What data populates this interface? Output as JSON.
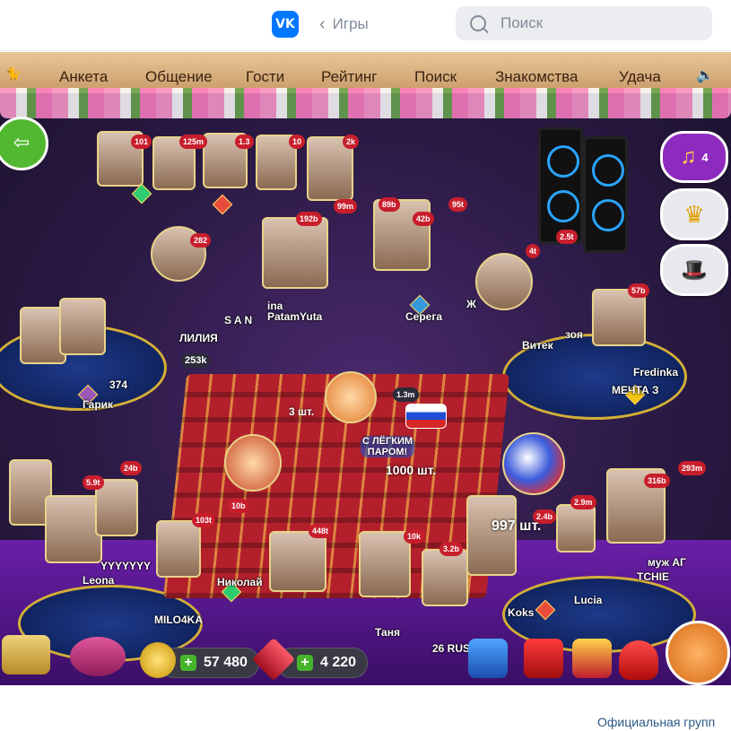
{
  "header": {
    "logo": "VK",
    "back_label": "Игры",
    "search_placeholder": "Поиск"
  },
  "game_nav": {
    "items": [
      "Анкета",
      "Общение",
      "Гости",
      "Рейтинг",
      "Поиск",
      "Знакомства",
      "Удача"
    ]
  },
  "badges": [
    "101",
    "125m",
    "1.3",
    "10",
    "2k",
    "99m",
    "89b",
    "42b",
    "95t",
    "192b",
    "282",
    "4t",
    "2.5t",
    "57b",
    "253k",
    "1.3m",
    "24b",
    "5.9t",
    "103t",
    "10b",
    "448t",
    "10k",
    "3.2b",
    "2.4b",
    "2.9m",
    "316b",
    "293m"
  ],
  "names": [
    "S A N",
    "ina",
    "PatamYuta",
    "Серега",
    "Ж",
    "ЛИЛИЯ",
    "Витек",
    "зоя",
    "Fredinka",
    "МЕЧТА З",
    "Гарик",
    "374",
    "Leona",
    "YYYYYYY",
    "Николай",
    "MILO4KA",
    "Таня",
    "26 RUS",
    "Koks",
    "Lucia",
    "муж АГ",
    "TCHIE"
  ],
  "gifts": {
    "gift1_count": "3 шт.",
    "gift2_count": "1000 шт.",
    "gift2_label": "С ЛЁГКИМ ПАРОМ!",
    "gift3_count": "997 шт."
  },
  "side_buttons": {
    "music_count": "4"
  },
  "bottom_bar": {
    "coins": "57 480",
    "rubies": "4 220"
  },
  "footer": {
    "link": "Официальная групп"
  },
  "colors": {
    "vk_blue": "#0077ff",
    "nav_wood": "#c99a66",
    "green_plus": "#47b52b",
    "badge_red": "#c81e2c",
    "purple_button": "#8e2bbf"
  },
  "icons": [
    "vk-logo",
    "chevron-left-icon",
    "search-icon",
    "cat-icon",
    "sound-icon",
    "exit-icon",
    "music-note-icon",
    "crown-icon",
    "hat-icon",
    "cat-face-icon",
    "chest-icon",
    "gift-box-icon",
    "crown-small-icon",
    "purse-icon",
    "coin-icon",
    "ruby-icon"
  ]
}
